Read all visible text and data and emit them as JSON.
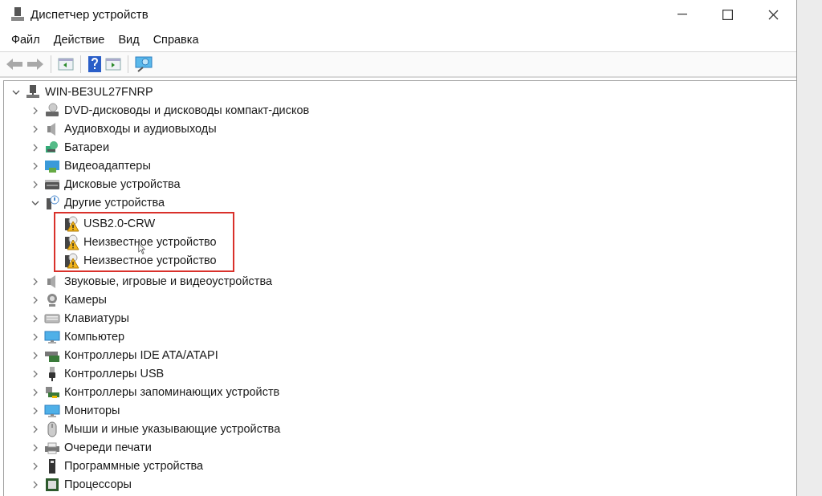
{
  "window": {
    "title": "Диспетчер устройств"
  },
  "menu": [
    "Файл",
    "Действие",
    "Вид",
    "Справка"
  ],
  "toolbar": [
    {
      "kind": "back",
      "disabled": true
    },
    {
      "kind": "forward",
      "disabled": true
    },
    {
      "kind": "sep"
    },
    {
      "kind": "pane"
    },
    {
      "kind": "sep"
    },
    {
      "kind": "help"
    },
    {
      "kind": "pane2"
    },
    {
      "kind": "sep"
    },
    {
      "kind": "scan"
    }
  ],
  "tree": {
    "label": "WIN-BE3UL27FNRP",
    "kind": "computer-root",
    "expanded": true,
    "children": [
      {
        "label": "DVD-дисководы и дисководы компакт-дисков",
        "kind": "dvd",
        "expanded": false
      },
      {
        "label": "Аудиовходы и аудиовыходы",
        "kind": "audio",
        "expanded": false
      },
      {
        "label": "Батареи",
        "kind": "battery",
        "expanded": false
      },
      {
        "label": "Видеоадаптеры",
        "kind": "display",
        "expanded": false
      },
      {
        "label": "Дисковые устройства",
        "kind": "disk",
        "expanded": false
      },
      {
        "label": "Другие устройства",
        "kind": "other",
        "expanded": true,
        "highlighted": true,
        "children": [
          {
            "label": "USB2.0-CRW",
            "kind": "warning"
          },
          {
            "label": "Неизвестное устройство",
            "kind": "warning"
          },
          {
            "label": "Неизвестное устройство",
            "kind": "warning"
          }
        ]
      },
      {
        "label": "Звуковые, игровые и видеоустройства",
        "kind": "audio",
        "expanded": false
      },
      {
        "label": "Камеры",
        "kind": "camera",
        "expanded": false
      },
      {
        "label": "Клавиатуры",
        "kind": "keyboard",
        "expanded": false
      },
      {
        "label": "Компьютер",
        "kind": "monitor",
        "expanded": false
      },
      {
        "label": "Контроллеры IDE ATA/ATAPI",
        "kind": "ide",
        "expanded": false
      },
      {
        "label": "Контроллеры USB",
        "kind": "usb",
        "expanded": false
      },
      {
        "label": "Контроллеры запоминающих устройств",
        "kind": "storage",
        "expanded": false
      },
      {
        "label": "Мониторы",
        "kind": "monitor",
        "expanded": false
      },
      {
        "label": "Мыши и иные указывающие устройства",
        "kind": "mouse",
        "expanded": false
      },
      {
        "label": "Очереди печати",
        "kind": "printer",
        "expanded": false
      },
      {
        "label": "Программные устройства",
        "kind": "firmware",
        "expanded": false
      },
      {
        "label": "Процессоры",
        "kind": "processor",
        "expanded": false
      }
    ]
  }
}
